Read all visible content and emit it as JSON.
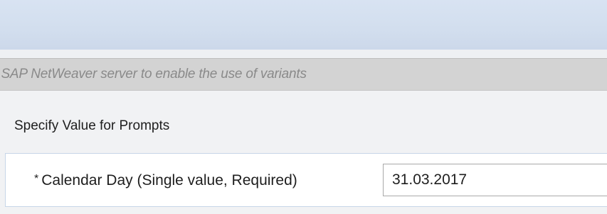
{
  "info_bar": {
    "text": "e SAP NetWeaver server to enable the use of variants"
  },
  "prompts_section": {
    "title": "Specify Value for Prompts",
    "prompt": {
      "required_marker": "*",
      "label": "Calendar Day (Single value, Required)",
      "value": "31.03.2017"
    }
  }
}
